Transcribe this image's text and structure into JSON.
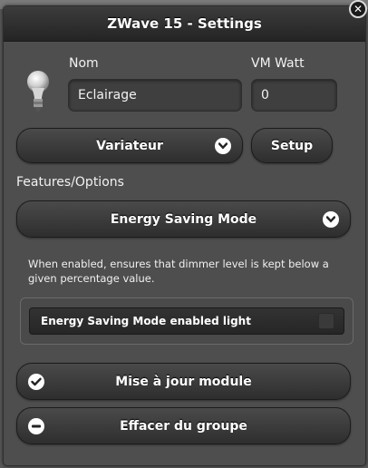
{
  "dialog": {
    "title": "ZWave 15 - Settings"
  },
  "device": {
    "icon": "light-bulb-icon",
    "name_label": "Nom",
    "name_value": "Eclairage",
    "vm_label": "VM Watt",
    "vm_value": "0"
  },
  "actions": {
    "type_select": "Variateur",
    "setup_label": "Setup"
  },
  "features": {
    "section_label": "Features/Options",
    "selected_option": "Energy Saving Mode",
    "help_text": "When enabled, ensures that dimmer level is kept below a given percentage value.",
    "toggle_label": "Energy Saving Mode enabled light",
    "toggle_on": false
  },
  "footer": {
    "update_label": "Mise à jour module",
    "remove_label": "Effacer du groupe"
  },
  "colors": {
    "background": "#595959",
    "panel": "#4e4e4e",
    "header": "#2b2b2b",
    "text": "#ffffff"
  }
}
